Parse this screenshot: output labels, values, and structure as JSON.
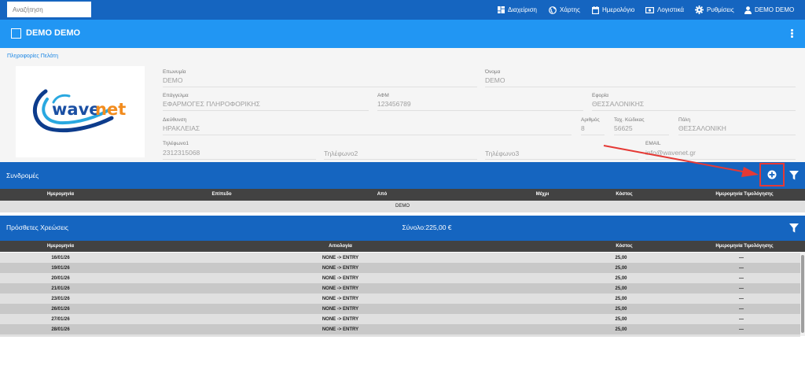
{
  "topbar": {
    "search_placeholder": "Αναζήτηση",
    "nav": [
      {
        "label": "Διαχείριση",
        "icon": "dashboard-icon"
      },
      {
        "label": "Χάρτης",
        "icon": "globe-icon"
      },
      {
        "label": "Ημερολόγιο",
        "icon": "calendar-icon"
      },
      {
        "label": "Λογιστικά",
        "icon": "money-icon"
      },
      {
        "label": "Ρυθμίσεις",
        "icon": "gear-icon"
      },
      {
        "label": "DEMO DEMO",
        "icon": "user-icon"
      }
    ]
  },
  "header": {
    "title": "DEMO DEMO"
  },
  "customer_info": {
    "link": "Πληροφορίες Πελάτη",
    "logo_text": "wavenet",
    "fields": {
      "brand_name": {
        "label": "Επωνυμία",
        "value": "DEMO"
      },
      "name": {
        "label": "Όνομα",
        "value": "DEMO"
      },
      "profession": {
        "label": "Επάγγελμα",
        "value": "ΕΦΑΡΜΟΓΕΣ ΠΛΗΡΟΦΟΡΙΚΗΣ"
      },
      "tax_id": {
        "label": "ΑΦΜ",
        "value": "123456789"
      },
      "tax_office": {
        "label": "Εφορία",
        "value": "ΘΕΣΣΑΛΟΝΙΚΗΣ"
      },
      "address": {
        "label": "Διεύθυνση",
        "value": "ΗΡΑΚΛΕΙΑΣ"
      },
      "number": {
        "label": "Αριθμός",
        "value": "8"
      },
      "postal_code": {
        "label": "Ταχ. Κώδικας",
        "value": "56625"
      },
      "city": {
        "label": "Πόλη",
        "value": "ΘΕΣΣΑΛΟΝΙΚΗ"
      },
      "phone1": {
        "label": "Τηλέφωνο1",
        "value": "2312315068"
      },
      "phone2": {
        "placeholder": "Τηλέφωνο2"
      },
      "phone3": {
        "placeholder": "Τηλέφωνο3"
      },
      "email": {
        "label": "EMAIL",
        "value": "info@wavenet.gr"
      }
    }
  },
  "subscriptions": {
    "title": "Συνδρομές",
    "columns": [
      "Ημερομηνία",
      "Επίπεδο",
      "Από",
      "Μέχρι",
      "Κόστος",
      "Ημερομηνία Τιμολόγησης"
    ],
    "empty_text": "DEMO"
  },
  "extra_charges": {
    "title": "Πρόσθετες Χρεώσεις",
    "total": "Σύνολο:225,00 €",
    "columns": [
      "Ημερομηνία",
      "Αιτιολογία",
      "Κόστος",
      "Ημερομηνία Τιμολόγησης"
    ],
    "rows": [
      {
        "date": "16/01/26",
        "reason": "NONE -> ENTRY",
        "cost": "25,00",
        "invoice_date": "—"
      },
      {
        "date": "19/01/26",
        "reason": "NONE -> ENTRY",
        "cost": "25,00",
        "invoice_date": "—"
      },
      {
        "date": "20/01/26",
        "reason": "NONE -> ENTRY",
        "cost": "25,00",
        "invoice_date": "—"
      },
      {
        "date": "21/01/26",
        "reason": "NONE -> ENTRY",
        "cost": "25,00",
        "invoice_date": "—"
      },
      {
        "date": "23/01/26",
        "reason": "NONE -> ENTRY",
        "cost": "25,00",
        "invoice_date": "—"
      },
      {
        "date": "26/01/26",
        "reason": "NONE -> ENTRY",
        "cost": "25,00",
        "invoice_date": "—"
      },
      {
        "date": "27/01/26",
        "reason": "NONE -> ENTRY",
        "cost": "25,00",
        "invoice_date": "—"
      },
      {
        "date": "28/01/26",
        "reason": "NONE -> ENTRY",
        "cost": "25,00",
        "invoice_date": "—"
      }
    ]
  },
  "colors": {
    "topbar": "#1565c0",
    "header": "#2196f3",
    "annotation": "#e53935"
  }
}
